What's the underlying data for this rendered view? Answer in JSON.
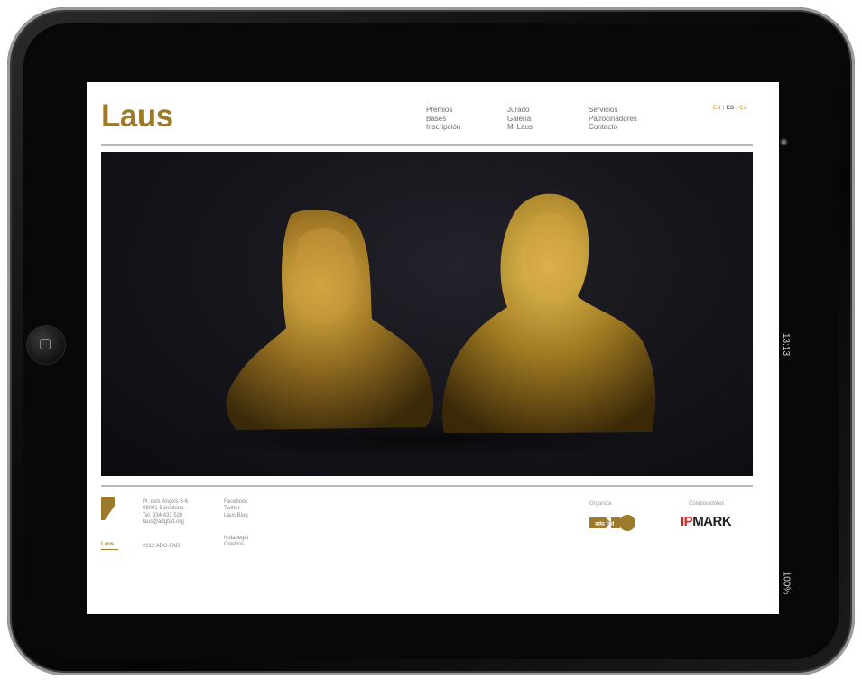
{
  "site": {
    "logo": "Laus",
    "nav_columns": [
      [
        "Premios",
        "Bases",
        "Inscripción"
      ],
      [
        "Jurado",
        "Galería",
        "Mi Laus"
      ],
      [
        "Servicios",
        "Patrocinadores",
        "Contacto"
      ]
    ],
    "languages": [
      "EN",
      "ES",
      "CA"
    ],
    "active_language": "ES"
  },
  "footer": {
    "address": [
      "Pl. dels Àngels 5-6",
      "08001 Barcelona",
      "Tel. 934 437 520",
      "laus@adgfad.org"
    ],
    "copyright": "2012 ADG-FAD",
    "social": [
      "Facebook",
      "Twitter",
      "Laus Blog"
    ],
    "legal": [
      "Nota legal",
      "Créditos"
    ],
    "logo_small": "Laus",
    "organiza_label": "Organiza",
    "colaboradores_label": "Colaboradores",
    "adg_logo_text": "adg fad",
    "ipmark": {
      "ip": "IP",
      "mark": "MARK"
    }
  },
  "device": {
    "status_time": "13:13",
    "status_battery": "100%"
  },
  "colors": {
    "gold": "#9c7a2c",
    "text_gray": "#6a6a6a",
    "ipmark_red": "#d9251c"
  },
  "icons": [
    "home-button-icon",
    "camera-icon",
    "battery-icon"
  ]
}
